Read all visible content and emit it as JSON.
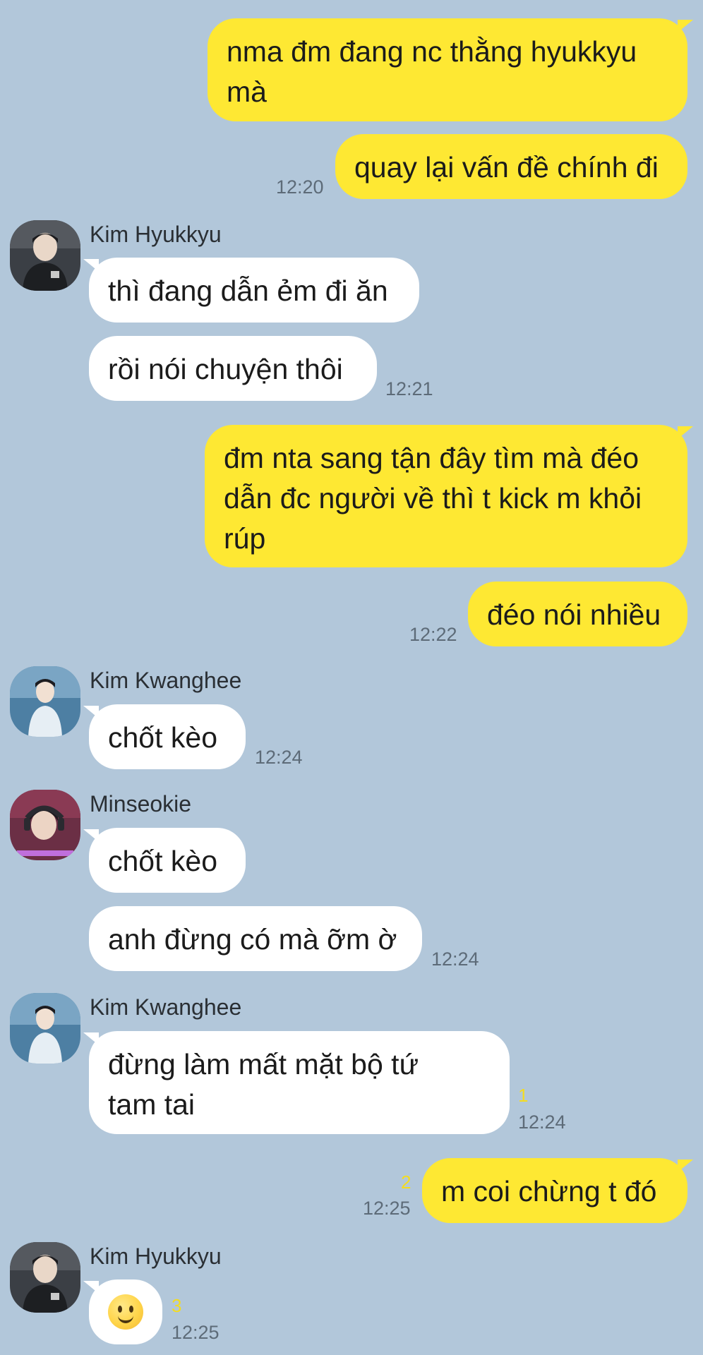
{
  "contacts": {
    "hyukkyu": "Kim Hyukkyu",
    "kwanghee": "Kim Kwanghee",
    "minseokie": "Minseokie"
  },
  "messages": [
    {
      "id": "m1",
      "sender": "me",
      "text": "nma đm đang nc thằng hyukkyu\nmà"
    },
    {
      "id": "m2",
      "sender": "me",
      "text": "quay lại vấn đề chính đi",
      "time": "12:20"
    },
    {
      "id": "m3",
      "sender": "Kim Hyukkyu",
      "text": "thì đang dẫn ẻm đi ăn"
    },
    {
      "id": "m4",
      "sender": "Kim Hyukkyu",
      "text": "rồi nói chuyện thôi",
      "time": "12:21"
    },
    {
      "id": "m5",
      "sender": "me",
      "text": "đm nta sang tận đây tìm mà đéo\ndẫn đc người về thì t kick m khỏi\nrúp"
    },
    {
      "id": "m6",
      "sender": "me",
      "text": "đéo nói nhiều",
      "time": "12:22"
    },
    {
      "id": "m7",
      "sender": "Kim Kwanghee",
      "text": "chốt kèo",
      "time": "12:24"
    },
    {
      "id": "m8",
      "sender": "Minseokie",
      "text": "chốt kèo"
    },
    {
      "id": "m9",
      "sender": "Minseokie",
      "text": "anh đừng có mà ỡm ờ",
      "time": "12:24"
    },
    {
      "id": "m10",
      "sender": "Kim Kwanghee",
      "text": "đừng làm mất mặt bộ tứ\ntam tai",
      "time": "12:24",
      "unread": "1"
    },
    {
      "id": "m11",
      "sender": "me",
      "text": "m coi chừng t đó",
      "time": "12:25",
      "unread": "2"
    },
    {
      "id": "m12",
      "sender": "Kim Hyukkyu",
      "emoji": "slightly-smiling-face-icon",
      "time": "12:25",
      "unread": "3"
    }
  ],
  "colors": {
    "background": "#b2c7da",
    "my_bubble": "#fee833",
    "their_bubble": "#ffffff",
    "unread_count": "#f4dc20",
    "timestamp": "#5d6b78"
  }
}
